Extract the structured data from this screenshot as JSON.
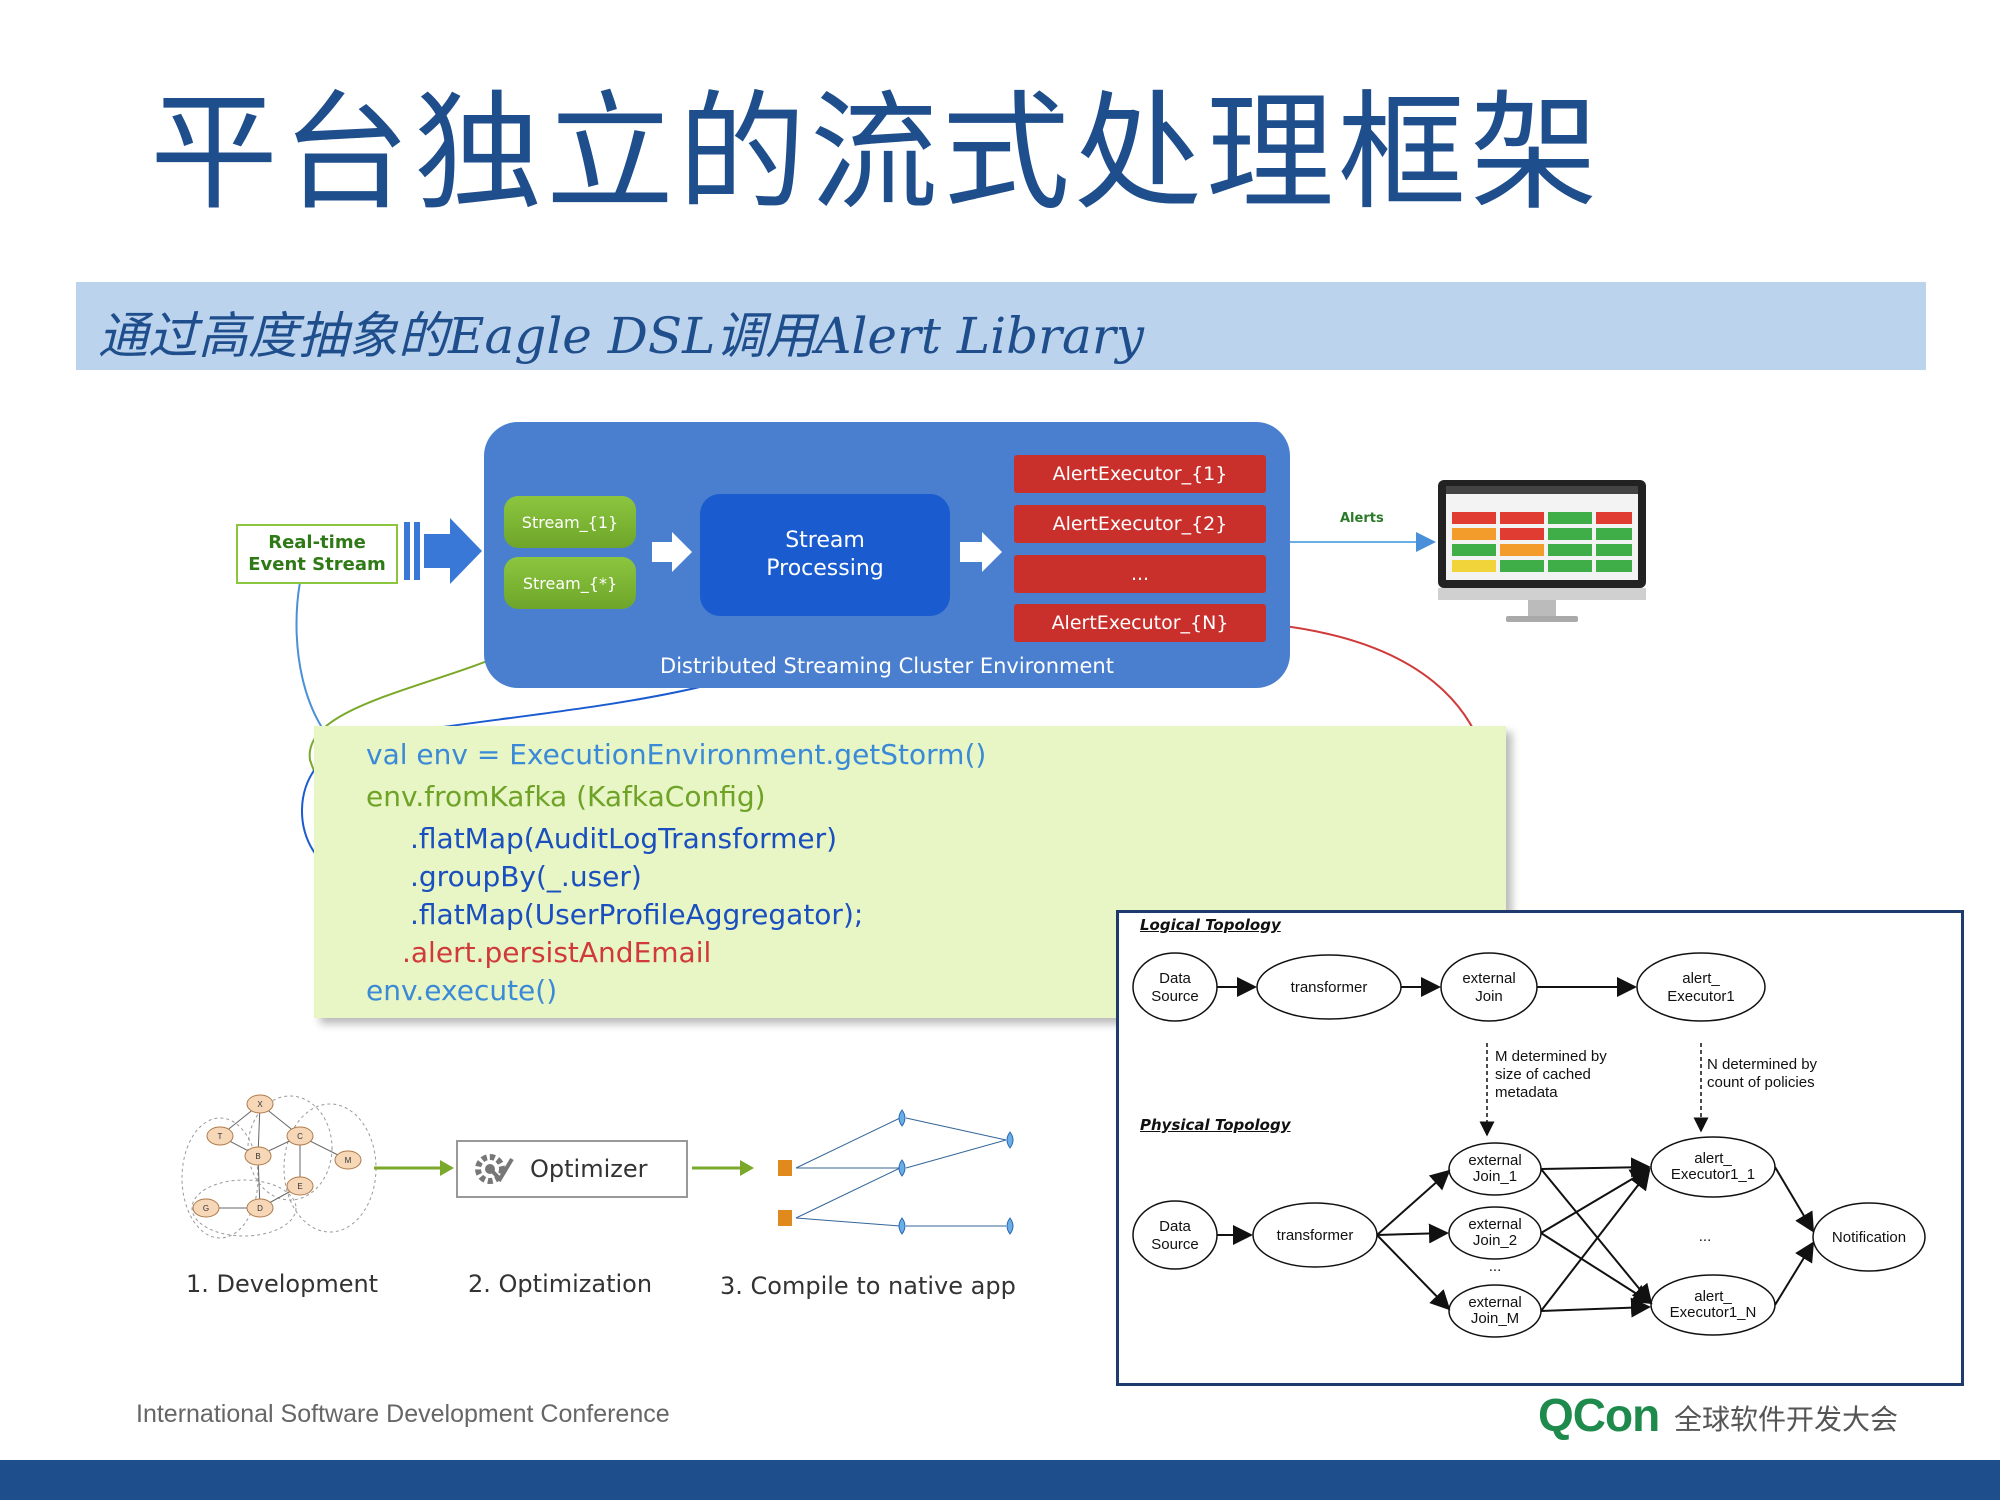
{
  "title": "平台独立的流式处理框架",
  "subtitle": "通过高度抽象的Eagle DSL调用Alert Library",
  "architecture": {
    "input_label_line1": "Real-time",
    "input_label_line2": "Event Stream",
    "streams": [
      "Stream_{1}",
      "Stream_{*}"
    ],
    "processing_line1": "Stream",
    "processing_line2": "Processing",
    "executors": [
      "AlertExecutor_{1}",
      "AlertExecutor_{2}",
      "...",
      "AlertExecutor_{N}"
    ],
    "cluster_label": "Distributed Streaming Cluster Environment",
    "alerts_label": "Alerts"
  },
  "code": {
    "line1": "val env = ExecutionEnvironment.getStorm()",
    "line2": "env.fromKafka (KafkaConfig)",
    "line3": ".flatMap(AuditLogTransformer)",
    "line4": ".groupBy(_.user)",
    "line5": ".flatMap(UserProfileAggregator);",
    "line6": ".alert.persistAndEmail",
    "line7": "env.execute()"
  },
  "topology": {
    "logical_title": "Logical Topology",
    "physical_title": "Physical Topology",
    "logical_nodes": [
      [
        "Data",
        "Source"
      ],
      [
        "transformer"
      ],
      [
        "external",
        "Join"
      ],
      [
        "alert_",
        "Executor1"
      ]
    ],
    "note_m": [
      "M determined by",
      "size of cached",
      "metadata"
    ],
    "note_n": [
      "N determined by",
      "count of policies"
    ],
    "physical_source": [
      "Data",
      "Source"
    ],
    "physical_transformer": "transformer",
    "joins": [
      [
        "external",
        "Join_1"
      ],
      [
        "external",
        "Join_2"
      ],
      [
        "external",
        "Join_M"
      ]
    ],
    "executors": [
      [
        "alert_",
        "Executor1_1"
      ],
      [
        "alert_",
        "Executor1_N"
      ]
    ],
    "notification": "Notification",
    "ellipsis": "..."
  },
  "pipeline": {
    "graph_nodes": [
      "X",
      "T",
      "C",
      "B",
      "M",
      "E",
      "G",
      "D"
    ],
    "optimizer_label": "Optimizer",
    "steps": [
      "1. Development",
      "2. Optimization",
      "3. Compile to native app"
    ]
  },
  "footer": {
    "conference": "International Software Development Conference",
    "brand": "QCon",
    "brand_cn": "全球软件开发大会"
  },
  "colors": {
    "title": "#1f4e8c",
    "subtitle_bar": "#bcd3ee",
    "cluster": "#4a7fd0",
    "stream_green": "#8cc63f",
    "executor_red": "#c9302c",
    "code_bg": "#e8f5c4",
    "footer_bar": "#1f4e8c",
    "brand_green": "#1e8a4c"
  }
}
